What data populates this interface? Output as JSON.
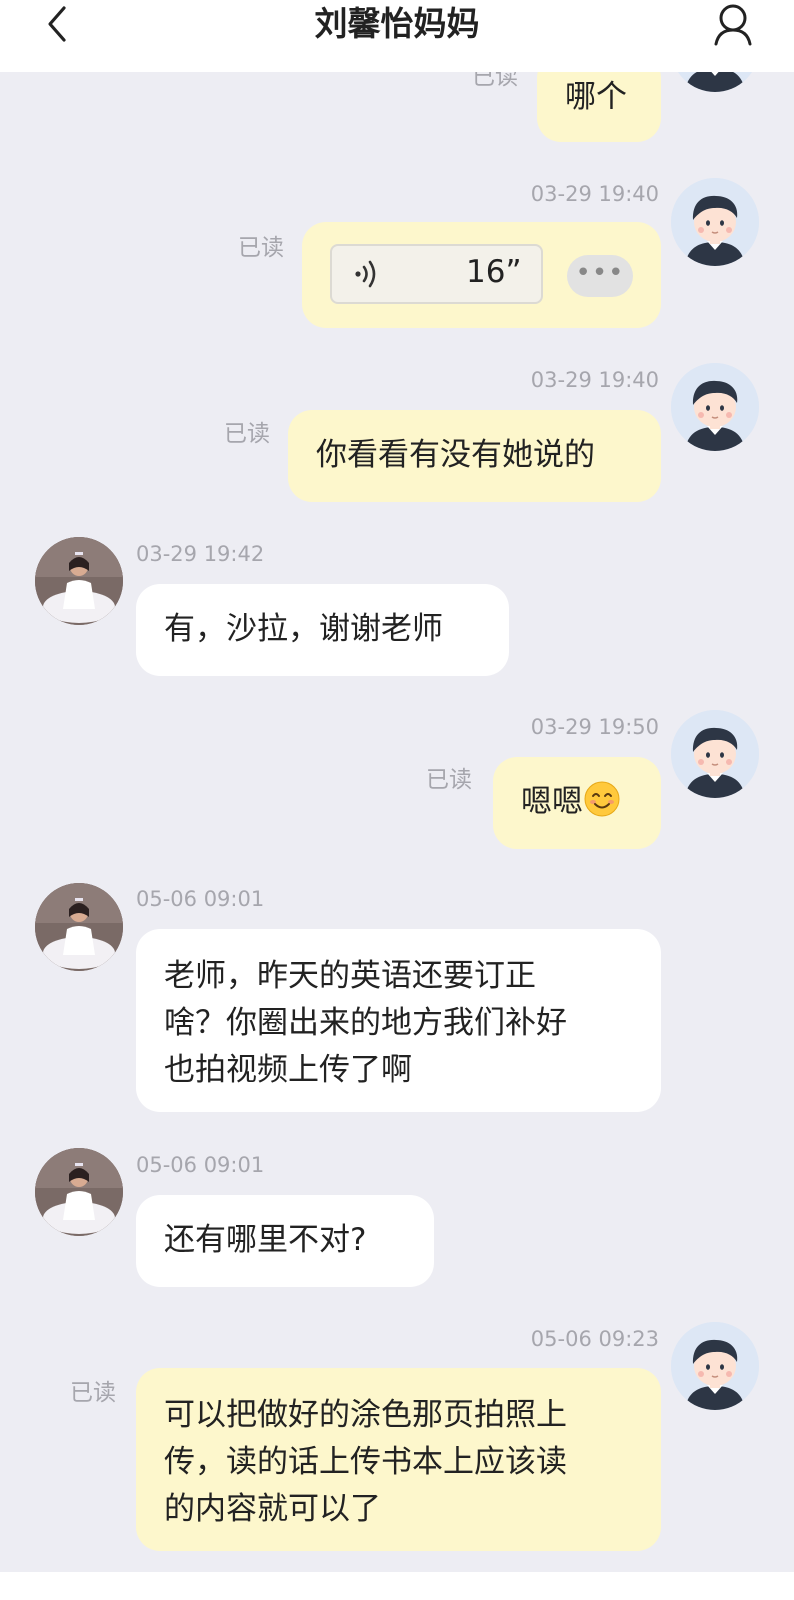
{
  "header": {
    "title": "刘馨怡妈妈",
    "back_icon": "chevron-left-icon",
    "profile_icon": "person-icon"
  },
  "colors": {
    "my_bubble": "#fdf7cc",
    "their_bubble": "#ffffff",
    "background": "#ededf3",
    "meta_text": "#a6a6ad"
  },
  "messages": [
    {
      "sender": "teacher",
      "read": "已读",
      "text": "哪个"
    },
    {
      "sender": "teacher",
      "time": "03-29 19:40",
      "read": "已读",
      "type": "voice",
      "duration": "16”",
      "more": "•••"
    },
    {
      "sender": "teacher",
      "time": "03-29 19:40",
      "read": "已读",
      "text": "你看看有没有她说的"
    },
    {
      "sender": "parent",
      "time": "03-29 19:42",
      "text": "有，沙拉，谢谢老师"
    },
    {
      "sender": "teacher",
      "time": "03-29 19:50",
      "read": "已读",
      "text": "嗯嗯",
      "emoji": "smiling-face-icon"
    },
    {
      "sender": "parent",
      "time": "05-06 09:01",
      "lines": [
        "老师，昨天的英语还要订正",
        "啥？你圈出来的地方我们补好",
        "也拍视频上传了啊"
      ]
    },
    {
      "sender": "parent",
      "time": "05-06 09:01",
      "text": "还有哪里不对?"
    },
    {
      "sender": "teacher",
      "time": "05-06 09:23",
      "read": "已读",
      "lines": [
        "可以把做好的涂色那页拍照上",
        "传，读的话上传书本上应该读",
        "的内容就可以了"
      ]
    }
  ]
}
